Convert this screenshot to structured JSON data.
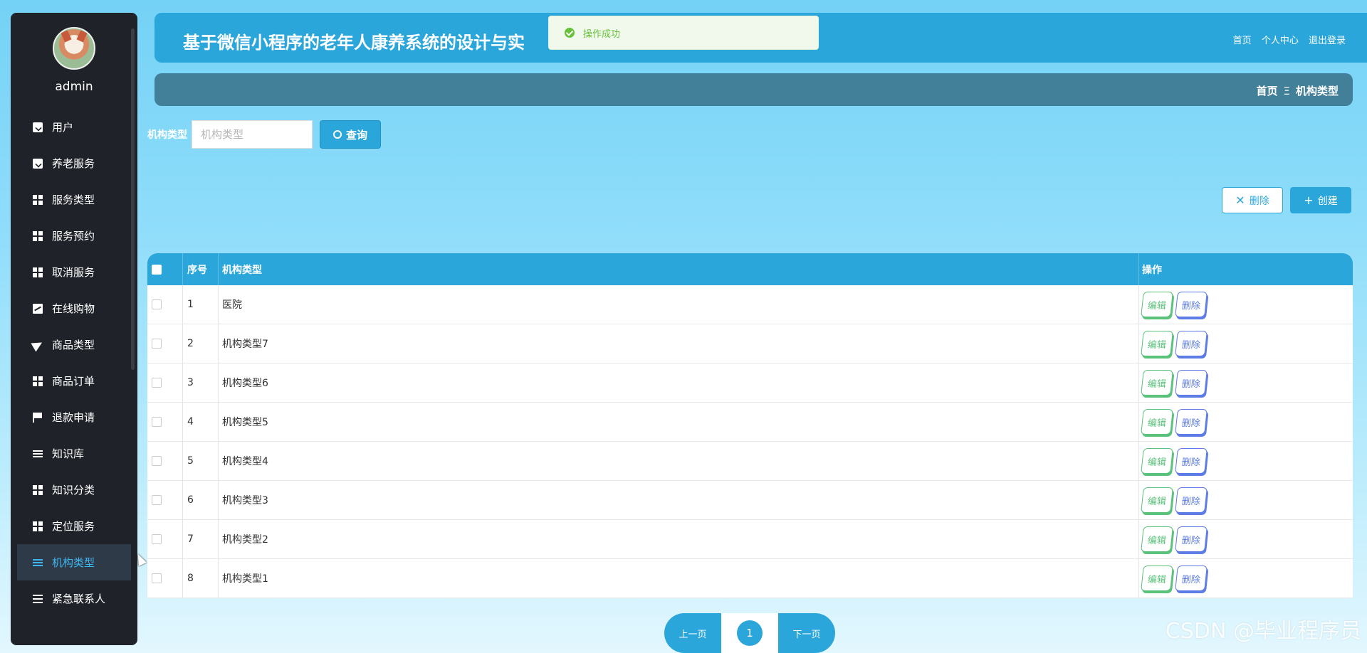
{
  "app": {
    "title": "基于微信小程序的老年人康养系统的设计与实",
    "top_links": [
      "首页",
      "个人中心",
      "退出登录"
    ]
  },
  "toast": {
    "message": "操作成功",
    "color": "#67c23a"
  },
  "user": {
    "name": "admin"
  },
  "sidebar": {
    "items": [
      {
        "label": "用户",
        "icon": "clipboard-icon"
      },
      {
        "label": "养老服务",
        "icon": "clipboard-check-icon"
      },
      {
        "label": "服务类型",
        "icon": "grid-icon"
      },
      {
        "label": "服务预约",
        "icon": "grid-icon"
      },
      {
        "label": "取消服务",
        "icon": "grid-icon"
      },
      {
        "label": "在线购物",
        "icon": "chart-icon"
      },
      {
        "label": "商品类型",
        "icon": "paper-plane-icon"
      },
      {
        "label": "商品订单",
        "icon": "grid-icon"
      },
      {
        "label": "退款申请",
        "icon": "flag-icon"
      },
      {
        "label": "知识库",
        "icon": "sliders-icon"
      },
      {
        "label": "知识分类",
        "icon": "grid-icon"
      },
      {
        "label": "定位服务",
        "icon": "grid-icon"
      },
      {
        "label": "机构类型",
        "icon": "sliders-icon",
        "active": true
      },
      {
        "label": "紧急联系人",
        "icon": "list-icon"
      }
    ]
  },
  "breadcrumb": {
    "home": "首页",
    "separator": "Ξ",
    "current": "机构类型"
  },
  "search": {
    "label": "机构类型",
    "placeholder": "机构类型",
    "button": "查询"
  },
  "actions": {
    "delete": "删除",
    "create": "创建"
  },
  "table": {
    "headers": {
      "index": "序号",
      "type": "机构类型",
      "ops": "操作"
    },
    "rows": [
      {
        "index": "1",
        "type": "医院"
      },
      {
        "index": "2",
        "type": "机构类型7"
      },
      {
        "index": "3",
        "type": "机构类型6"
      },
      {
        "index": "4",
        "type": "机构类型5"
      },
      {
        "index": "5",
        "type": "机构类型4"
      },
      {
        "index": "6",
        "type": "机构类型3"
      },
      {
        "index": "7",
        "type": "机构类型2"
      },
      {
        "index": "8",
        "type": "机构类型1"
      }
    ],
    "edit_label": "编辑",
    "delete_label": "删除"
  },
  "pager": {
    "prev": "上一页",
    "current": "1",
    "next": "下一页"
  },
  "watermark": "CSDN @毕业程序员",
  "colors": {
    "primary": "#2ba6da",
    "sidebar_bg": "#1f2329",
    "breadcrumb_bg": "#427f98",
    "edit": "#5bc27c",
    "delete": "#5d7ce6"
  }
}
